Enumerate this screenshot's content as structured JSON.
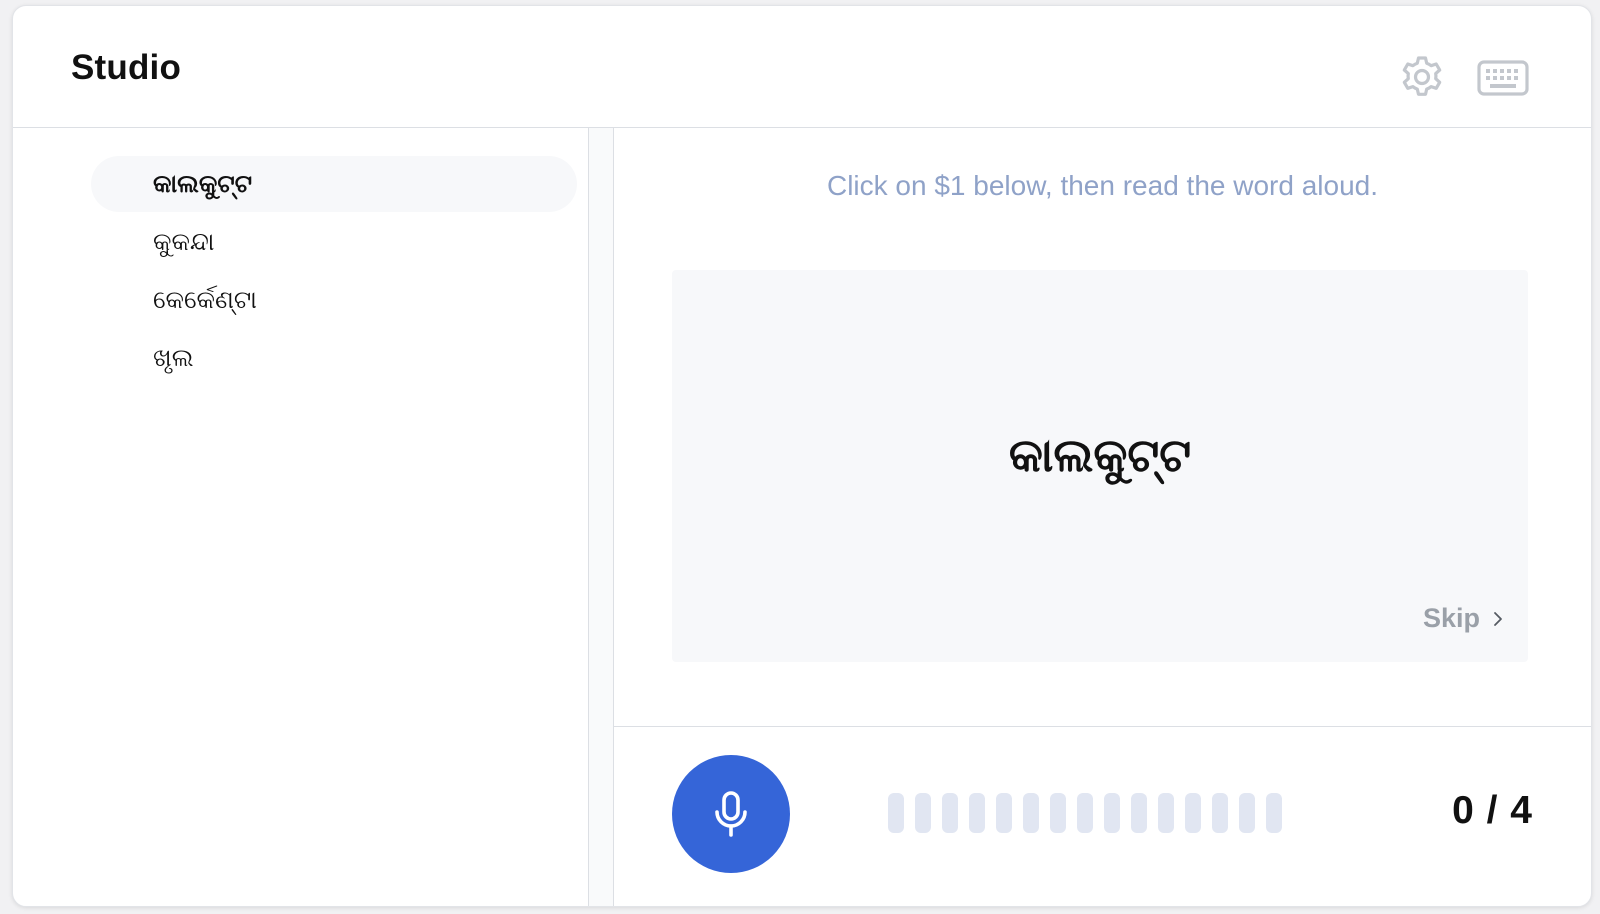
{
  "app": {
    "title": "Studio"
  },
  "header": {
    "icons": [
      "gear-icon",
      "keyboard-icon"
    ]
  },
  "sidebar": {
    "items": [
      {
        "label": "କାଲକୁଟ୍ଟ",
        "active": true
      },
      {
        "label": "କୁକନ୍ଦା",
        "active": false
      },
      {
        "label": "କେର୍କେଣ୍ଟା",
        "active": false
      },
      {
        "label": "ଖୃଲ",
        "active": false
      }
    ]
  },
  "main": {
    "instruction": "Click on $1 below, then read the word aloud.",
    "current_word": "କାଲକୁଟ୍ଟ",
    "skip_label": "Skip"
  },
  "recorder": {
    "level_bar_count": 15,
    "progress_text": "0 / 4",
    "accent_color": "#3565d8"
  }
}
